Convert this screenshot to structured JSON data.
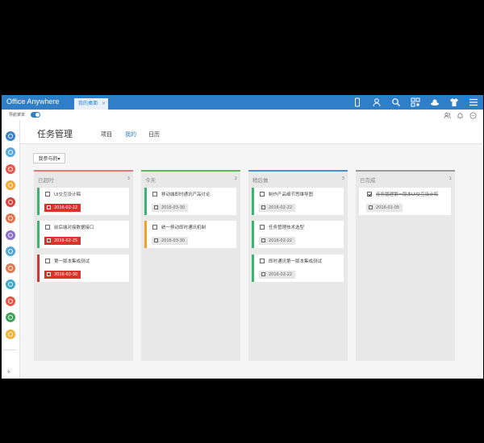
{
  "colors": {
    "brand": "#2f7fc8",
    "overdue": "#d9342b",
    "today": "#3cb371",
    "upcoming": "#4a90d9",
    "later": "#f0a030"
  },
  "app": {
    "title": "Office Anywhere",
    "tab_label": "我的桌面",
    "tab_close": "×"
  },
  "topbar_icons": [
    "mobile-icon",
    "user-icon",
    "search-icon",
    "qr-icon",
    "hat-icon",
    "shirt-icon",
    "menu-icon"
  ],
  "nav": {
    "label": "导航菜单"
  },
  "tools": [
    "people-icon",
    "bell-icon",
    "chat-icon"
  ],
  "sidebar_icons": [
    "#3d82c8",
    "#5aa8e0",
    "#e05a4c",
    "#f2a93b",
    "#d3453b",
    "#e3734a",
    "#8a72c9",
    "#4ea7d4",
    "#e07a52",
    "#3fa7c9",
    "#e25648",
    "#43a35b",
    "#f1b236"
  ],
  "page": {
    "title": "任务管理",
    "tabs": [
      "项目",
      "我的",
      "日历"
    ],
    "active_tab": "我的",
    "filter_label": "我参与的▾"
  },
  "columns": [
    {
      "title": "已超时",
      "count": "3",
      "color": "#e77a74",
      "cards": [
        {
          "text": "UI交互设计稿",
          "date": "2016-02-22",
          "bar": "#3cb371",
          "date_style": "red",
          "done": false
        },
        {
          "text": "前后端对接数据接口",
          "date": "2016-02-25",
          "bar": "#3cb371",
          "date_style": "red",
          "done": false
        },
        {
          "text": "第一版本集成测试",
          "date": "2016-02-30",
          "bar": "#d9342b",
          "date_style": "red",
          "done": false
        }
      ]
    },
    {
      "title": "今天",
      "count": "2",
      "color": "#5cb85c",
      "cards": [
        {
          "text": "移动端即时通讯产品讨论",
          "date": "2016-03-30",
          "bar": "#3cb371",
          "date_style": "grey",
          "done": false
        },
        {
          "text": "统一移动即时通讯机制",
          "date": "2016-03-30",
          "bar": "#f0a030",
          "date_style": "grey",
          "done": false
        }
      ]
    },
    {
      "title": "稍后做",
      "count": "3",
      "color": "#4a90d9",
      "cards": [
        {
          "text": "制作产品细节思维导图",
          "date": "2016-02-22",
          "bar": "#3cb371",
          "date_style": "grey",
          "done": false
        },
        {
          "text": "任务管理技术选型",
          "date": "2016-02-22",
          "bar": "#3cb371",
          "date_style": "grey",
          "done": false
        },
        {
          "text": "即时通讯第一版本集成测试",
          "date": "2016-02-22",
          "bar": "#3cb371",
          "date_style": "grey",
          "done": false
        }
      ]
    },
    {
      "title": "已完成",
      "count": "1",
      "color": "#999999",
      "cards": [
        {
          "text": "任务管理第一版本UI交互设计稿",
          "date": "2016-01-05",
          "bar": "#ffffff",
          "date_style": "grey",
          "done": true
        }
      ]
    }
  ]
}
